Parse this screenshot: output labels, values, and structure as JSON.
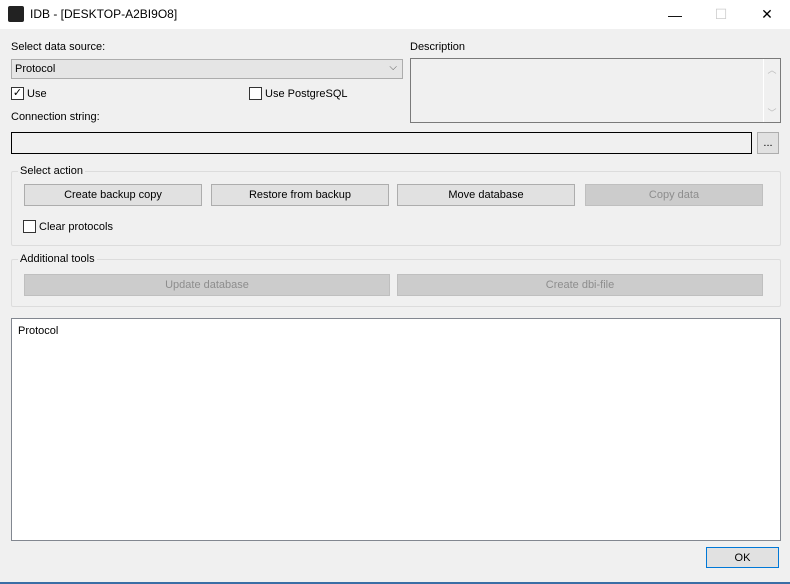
{
  "window": {
    "title": "IDB - [DESKTOP-A2BI9O8]",
    "minimize": "—",
    "maximize": "☐",
    "close": "✕"
  },
  "source": {
    "label": "Select data source:",
    "selected": "Protocol",
    "use_label": "Use",
    "use_checked": true,
    "postgres_label": "Use PostgreSQL",
    "postgres_checked": false
  },
  "description": {
    "label": "Description",
    "value": ""
  },
  "connection": {
    "label": "Connection string:",
    "value": "",
    "browse": "..."
  },
  "select_action": {
    "label": "Select action",
    "buttons": [
      "Create backup copy",
      "Restore from backup",
      "Move database",
      "Copy data"
    ],
    "clear_label": "Clear protocols"
  },
  "additional_tools": {
    "label": "Additional tools",
    "buttons": [
      "Update database",
      "Create dbi-file"
    ]
  },
  "protocol": {
    "text": "Protocol"
  },
  "ok": "OK"
}
